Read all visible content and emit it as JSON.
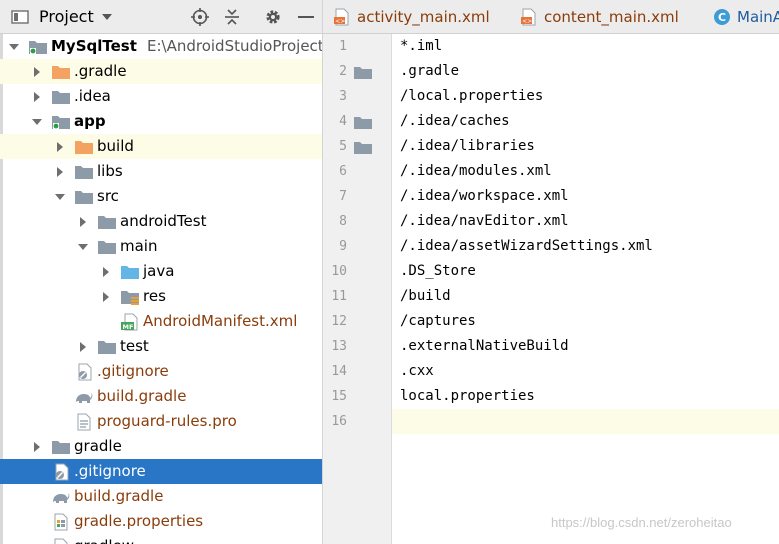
{
  "project_panel": {
    "title": "Project",
    "tree": [
      {
        "label": "MySqlTest",
        "path": "E:\\AndroidStudioProjects",
        "indent": 0,
        "chevron": "down",
        "icon": "module",
        "bold": true
      },
      {
        "label": ".gradle",
        "indent": 1,
        "chevron": "right",
        "icon": "folder-orange",
        "highlight": true
      },
      {
        "label": ".idea",
        "indent": 1,
        "chevron": "right",
        "icon": "folder"
      },
      {
        "label": "app",
        "indent": 1,
        "chevron": "down",
        "icon": "module",
        "bold": true
      },
      {
        "label": "build",
        "indent": 2,
        "chevron": "right",
        "icon": "folder-orange",
        "highlight": true
      },
      {
        "label": "libs",
        "indent": 2,
        "chevron": "right",
        "icon": "folder"
      },
      {
        "label": "src",
        "indent": 2,
        "chevron": "down",
        "icon": "folder"
      },
      {
        "label": "androidTest",
        "indent": 3,
        "chevron": "right",
        "icon": "folder"
      },
      {
        "label": "main",
        "indent": 3,
        "chevron": "down",
        "icon": "folder"
      },
      {
        "label": "java",
        "indent": 4,
        "chevron": "right",
        "icon": "folder-blue"
      },
      {
        "label": "res",
        "indent": 4,
        "chevron": "right",
        "icon": "folder-res"
      },
      {
        "label": "AndroidManifest.xml",
        "indent": 4,
        "chevron": "none",
        "icon": "manifest",
        "git": true
      },
      {
        "label": "test",
        "indent": 3,
        "chevron": "right",
        "icon": "folder"
      },
      {
        "label": ".gitignore",
        "indent": 2,
        "chevron": "none",
        "icon": "gitignore",
        "git": true
      },
      {
        "label": "build.gradle",
        "indent": 2,
        "chevron": "none",
        "icon": "gradle",
        "git": true
      },
      {
        "label": "proguard-rules.pro",
        "indent": 2,
        "chevron": "none",
        "icon": "textfile",
        "git": true
      },
      {
        "label": "gradle",
        "indent": 1,
        "chevron": "right",
        "icon": "folder"
      },
      {
        "label": ".gitignore",
        "indent": 1,
        "chevron": "none",
        "icon": "gitignore",
        "selected": true
      },
      {
        "label": "build.gradle",
        "indent": 1,
        "chevron": "none",
        "icon": "gradle",
        "git": true
      },
      {
        "label": "gradle.properties",
        "indent": 1,
        "chevron": "none",
        "icon": "properties",
        "git": true
      },
      {
        "label": "gradlew",
        "indent": 1,
        "chevron": "none",
        "icon": "textfile"
      }
    ]
  },
  "tabs": [
    {
      "label": "activity_main.xml",
      "icon": "xml-file"
    },
    {
      "label": "content_main.xml",
      "icon": "xml-file"
    },
    {
      "label": "MainActivity.java",
      "icon": "class-file",
      "kt": true
    }
  ],
  "editor": {
    "lines": [
      {
        "num": "1",
        "text": "*.iml",
        "fold": false
      },
      {
        "num": "2",
        "text": ".gradle",
        "fold": true
      },
      {
        "num": "3",
        "text": "/local.properties",
        "fold": false
      },
      {
        "num": "4",
        "text": "/.idea/caches",
        "fold": true
      },
      {
        "num": "5",
        "text": "/.idea/libraries",
        "fold": true
      },
      {
        "num": "6",
        "text": "/.idea/modules.xml",
        "fold": false
      },
      {
        "num": "7",
        "text": "/.idea/workspace.xml",
        "fold": false
      },
      {
        "num": "8",
        "text": "/.idea/navEditor.xml",
        "fold": false
      },
      {
        "num": "9",
        "text": "/.idea/assetWizardSettings.xml",
        "fold": false
      },
      {
        "num": "10",
        "text": ".DS_Store",
        "fold": false
      },
      {
        "num": "11",
        "text": "/build",
        "fold": false
      },
      {
        "num": "12",
        "text": "/captures",
        "fold": false
      },
      {
        "num": "13",
        "text": ".externalNativeBuild",
        "fold": false
      },
      {
        "num": "14",
        "text": ".cxx",
        "fold": false
      },
      {
        "num": "15",
        "text": "local.properties",
        "fold": false
      },
      {
        "num": "16",
        "text": "",
        "fold": false,
        "current": true
      }
    ]
  },
  "watermark": "https://blog.csdn.net/zeroheitao",
  "colors": {
    "selection": "#2a76c6",
    "highlight_row": "#fdfce6",
    "git_text": "#8a3d0b",
    "folder": "#8d9aa7",
    "folder_orange": "#f4a261"
  }
}
